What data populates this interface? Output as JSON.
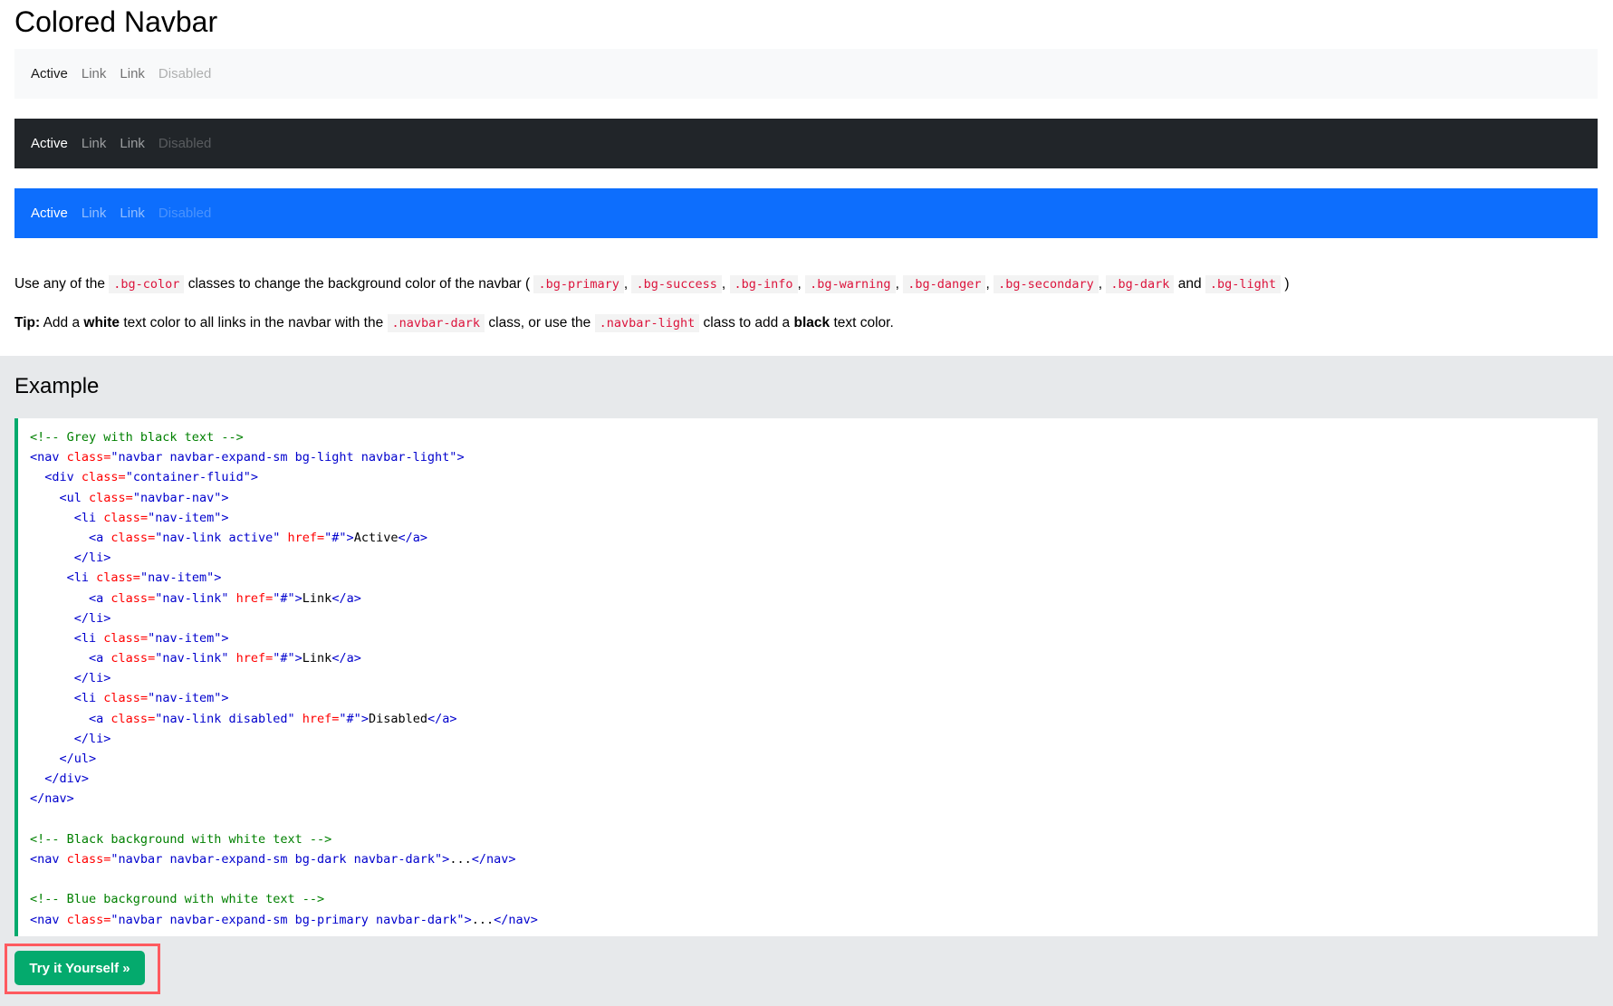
{
  "page_title": "Colored Navbar",
  "navbars": {
    "light": {
      "active": "Active",
      "link1": "Link",
      "link2": "Link",
      "disabled": "Disabled"
    },
    "dark": {
      "active": "Active",
      "link1": "Link",
      "link2": "Link",
      "disabled": "Disabled"
    },
    "primary": {
      "active": "Active",
      "link1": "Link",
      "link2": "Link",
      "disabled": "Disabled"
    }
  },
  "description": {
    "p1_start": "Use any of the ",
    "p1_bgcolor": ".bg-color",
    "p1_mid": " classes to change the background color of the navbar ( ",
    "p1_primary": ".bg-primary",
    "p1_success": ".bg-success",
    "p1_info": ".bg-info",
    "p1_warning": ".bg-warning",
    "p1_danger": ".bg-danger",
    "p1_secondary": ".bg-secondary",
    "p1_dark": ".bg-dark",
    "p1_and": " and ",
    "p1_light": ".bg-light",
    "p1_end": " )",
    "sep": ", ",
    "tip_label": "Tip:",
    "tip_1": " Add a ",
    "tip_white": "white",
    "tip_2": " text color to all links in the navbar with the ",
    "tip_navbar_dark": ".navbar-dark",
    "tip_3": " class, or use the ",
    "tip_navbar_light": ".navbar-light",
    "tip_4": " class to add a ",
    "tip_black": "black",
    "tip_5": " text color."
  },
  "example": {
    "title": "Example",
    "try_button": "Try it Yourself »",
    "code": {
      "l1_comment": "<!-- Grey with black text -->",
      "l2_open": "<nav",
      "l2_attr": " class=",
      "l2_val": "\"navbar navbar-expand-sm bg-light navbar-light\"",
      "l2_close": ">",
      "l3_open": "<div",
      "l3_attr": " class=",
      "l3_val": "\"container-fluid\"",
      "l3_close": ">",
      "l4_open": "<ul",
      "l4_attr": " class=",
      "l4_val": "\"navbar-nav\"",
      "l4_close": ">",
      "li_open": "<li",
      "li_attr": " class=",
      "li_val": "\"nav-item\"",
      "li_close": ">",
      "a_open": "<a",
      "a_class_attr": " class=",
      "a_active_val": "\"nav-link active\"",
      "a_link_val": "\"nav-link\"",
      "a_disabled_val": "\"nav-link disabled\"",
      "a_href_attr": " href=",
      "a_href_val": "\"#\"",
      "a_gt": ">",
      "a_active_text": "Active",
      "a_link_text": "Link",
      "a_disabled_text": "Disabled",
      "a_end": "</a>",
      "li_end": "</li>",
      "ul_end": "</ul>",
      "div_end": "</div>",
      "nav_end": "</nav>",
      "c2_comment": "<!-- Black background with white text -->",
      "c2_val": "\"navbar navbar-expand-sm bg-dark navbar-dark\"",
      "c3_comment": "<!-- Blue background with white text -->",
      "c3_val": "\"navbar navbar-expand-sm bg-primary navbar-dark\"",
      "ellipsis": "..."
    }
  },
  "colors": {
    "primary": "#0d6efd",
    "dark": "#212529",
    "light": "#f8f9fa",
    "accent_green": "#04aa6d",
    "highlight_red": "#ff5a5f"
  }
}
